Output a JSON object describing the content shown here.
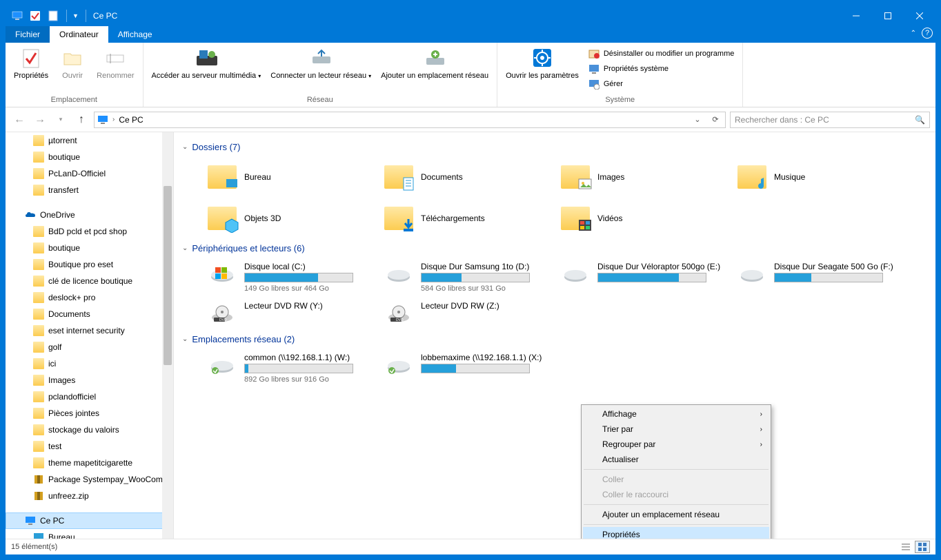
{
  "title": "Ce PC",
  "tabs": {
    "file": "Fichier",
    "computer": "Ordinateur",
    "view": "Affichage"
  },
  "ribbon": {
    "groups": {
      "location": {
        "label": "Emplacement",
        "properties": "Propriétés",
        "open": "Ouvrir",
        "rename": "Renommer"
      },
      "network": {
        "label": "Réseau",
        "media": "Accéder au serveur multimédia",
        "mapdrive": "Connecter un lecteur réseau",
        "addloc": "Ajouter un emplacement réseau"
      },
      "system": {
        "label": "Système",
        "settings": "Ouvrir les paramètres",
        "uninstall": "Désinstaller ou modifier un programme",
        "sysprops": "Propriétés système",
        "manage": "Gérer"
      }
    }
  },
  "breadcrumb": {
    "item": "Ce PC"
  },
  "search": {
    "placeholder": "Rechercher dans : Ce PC"
  },
  "tree": {
    "items": [
      {
        "label": "µtorrent",
        "icon": "folder",
        "lvl": 1
      },
      {
        "label": "boutique",
        "icon": "folder",
        "lvl": 1
      },
      {
        "label": "PcLanD-Officiel",
        "icon": "folder",
        "lvl": 1
      },
      {
        "label": "transfert",
        "icon": "folder",
        "lvl": 1
      },
      {
        "label": "",
        "icon": "blank",
        "lvl": 1
      },
      {
        "label": "OneDrive",
        "icon": "onedrive",
        "lvl": 0
      },
      {
        "label": "BdD pcld et pcd shop",
        "icon": "folder",
        "lvl": 1
      },
      {
        "label": "boutique",
        "icon": "folder",
        "lvl": 1
      },
      {
        "label": "Boutique pro eset",
        "icon": "folder",
        "lvl": 1
      },
      {
        "label": "clé de licence boutique",
        "icon": "folder",
        "lvl": 1
      },
      {
        "label": "deslock+ pro",
        "icon": "folder",
        "lvl": 1
      },
      {
        "label": "Documents",
        "icon": "folder",
        "lvl": 1
      },
      {
        "label": "eset internet security",
        "icon": "folder",
        "lvl": 1
      },
      {
        "label": "golf",
        "icon": "folder",
        "lvl": 1
      },
      {
        "label": "ici",
        "icon": "folder",
        "lvl": 1
      },
      {
        "label": "Images",
        "icon": "folder",
        "lvl": 1
      },
      {
        "label": "pclandofficiel",
        "icon": "folder",
        "lvl": 1
      },
      {
        "label": "Pièces jointes",
        "icon": "folder",
        "lvl": 1
      },
      {
        "label": "stockage du valoirs",
        "icon": "folder",
        "lvl": 1
      },
      {
        "label": "test",
        "icon": "folder",
        "lvl": 1
      },
      {
        "label": "theme mapetitcigarette",
        "icon": "folder",
        "lvl": 1
      },
      {
        "label": "Package Systempay_WooCommer",
        "icon": "zip",
        "lvl": 1
      },
      {
        "label": "unfreez.zip",
        "icon": "zip",
        "lvl": 1
      },
      {
        "label": "",
        "icon": "blank",
        "lvl": 1
      },
      {
        "label": "Ce PC",
        "icon": "pc",
        "lvl": 0,
        "selected": true
      },
      {
        "label": "Bureau",
        "icon": "desktop",
        "lvl": 1
      }
    ]
  },
  "content": {
    "folders": {
      "header": "Dossiers (7)",
      "items": [
        {
          "name": "Bureau",
          "overlay": "desktop"
        },
        {
          "name": "Documents",
          "overlay": "doc"
        },
        {
          "name": "Images",
          "overlay": "pic"
        },
        {
          "name": "Musique",
          "overlay": "music"
        },
        {
          "name": "Objets 3D",
          "overlay": "3d"
        },
        {
          "name": "Téléchargements",
          "overlay": "dl"
        },
        {
          "name": "Vidéos",
          "overlay": "vid"
        }
      ]
    },
    "drives": {
      "header": "Périphériques et lecteurs (6)",
      "items": [
        {
          "name": "Disque local (C:)",
          "free": "149 Go libres sur 464 Go",
          "pct": 68,
          "type": "os"
        },
        {
          "name": "Disque Dur Samsung 1to (D:)",
          "free": "584 Go libres sur 931 Go",
          "pct": 37,
          "type": "hdd"
        },
        {
          "name": "Disque Dur Véloraptor 500go (E:)",
          "free": "",
          "pct": 75,
          "type": "hdd"
        },
        {
          "name": "Disque Dur Seagate 500 Go (F:)",
          "free": "",
          "pct": 34,
          "type": "hdd"
        },
        {
          "name": "Lecteur DVD RW (Y:)",
          "free": "",
          "pct": -1,
          "type": "dvd"
        },
        {
          "name": "Lecteur DVD RW (Z:)",
          "free": "",
          "pct": -1,
          "type": "dvd"
        }
      ]
    },
    "network": {
      "header": "Emplacements réseau (2)",
      "items": [
        {
          "name": "common (\\\\192.168.1.1) (W:)",
          "free": "892 Go libres sur 916 Go",
          "pct": 3
        },
        {
          "name": "lobbemaxime (\\\\192.168.1.1) (X:)",
          "free": "",
          "pct": 32
        }
      ]
    }
  },
  "context_menu": {
    "view": "Affichage",
    "sort": "Trier par",
    "group": "Regrouper par",
    "refresh": "Actualiser",
    "paste": "Coller",
    "paste_shortcut": "Coller le raccourci",
    "add_network": "Ajouter un emplacement réseau",
    "properties": "Propriétés"
  },
  "status": {
    "text": "15 élément(s)"
  }
}
